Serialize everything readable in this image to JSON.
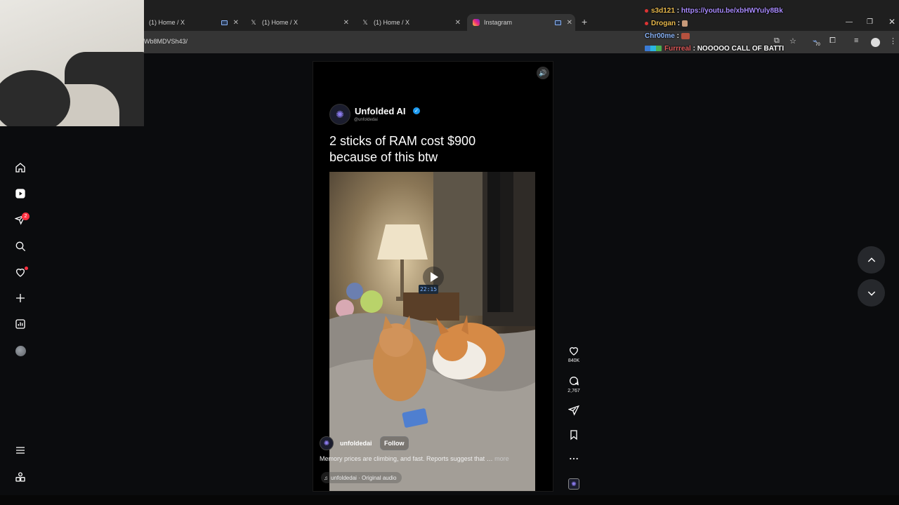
{
  "browser": {
    "tabs": [
      {
        "title": "(1) Home / X",
        "icon": "x-logo-icon"
      },
      {
        "title": "(1) Home / X",
        "icon": "x-logo-icon"
      },
      {
        "title": "(1) Home / X",
        "icon": "x-logo-icon"
      },
      {
        "title": "Instagram",
        "icon": "instagram-icon",
        "active": true
      }
    ],
    "url": "Wb8MDVSh43/",
    "extension_badge": "70"
  },
  "chat": [
    {
      "user": "s3d121",
      "message": "https://youtu.be/xbHWYuly8Bk",
      "is_link": true
    },
    {
      "user": "Drogan",
      "message": "",
      "emote": "emote"
    },
    {
      "user": "Chr00me",
      "message": "",
      "emote": "emote"
    },
    {
      "user": "Furrreal",
      "message": "NOOOOO CALL OF BATTI"
    }
  ],
  "sidebar": {
    "items": [
      {
        "name": "home",
        "icon": "home-icon"
      },
      {
        "name": "reels",
        "icon": "reels-icon"
      },
      {
        "name": "messages",
        "icon": "paper-plane-icon",
        "badge": "2"
      },
      {
        "name": "search",
        "icon": "search-icon"
      },
      {
        "name": "notifications",
        "icon": "heart-icon"
      },
      {
        "name": "create",
        "icon": "plus-icon"
      },
      {
        "name": "dashboard",
        "icon": "dashboard-icon"
      },
      {
        "name": "profile",
        "icon": "avatar"
      }
    ],
    "menu_icon": "hamburger-icon",
    "more_icon": "also-from-meta-icon"
  },
  "reel": {
    "tweet_author": "Unfolded AI",
    "tweet_handle": "@unfoldedai",
    "headline": "2 sticks of RAM cost $900 because of this btw",
    "clock_display": "22:15",
    "username": "unfoldedai",
    "follow_label": "Follow",
    "caption": "Memory prices are climbing, and fast. Reports suggest that …",
    "more_label": "more",
    "audio": "unfoldedai · Original audio"
  },
  "actions": {
    "likes": "840K",
    "comments": "2,767"
  },
  "colors": {
    "background": "#0b0c0e",
    "accent_link": "#a98bff",
    "badge_red": "#ff3040",
    "verified_blue": "#1d9bf0"
  }
}
